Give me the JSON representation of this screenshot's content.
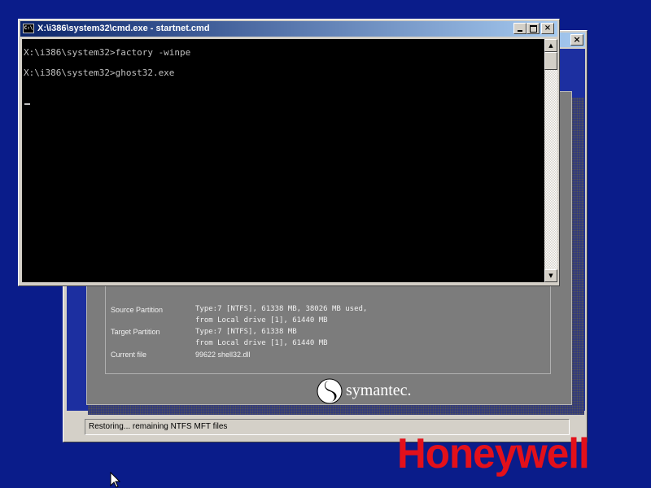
{
  "desktop": {
    "background_color": "#0a1c8a"
  },
  "ghost": {
    "close_glyph": "×",
    "details": [
      {
        "label": "Source Partition",
        "value": "Type:7 [NTFS], 61338 MB, 38026 MB used,"
      },
      {
        "label": "",
        "value": "from Local drive [1], 61440 MB"
      },
      {
        "label": "Target Partition",
        "value": "Type:7 [NTFS], 61338 MB"
      },
      {
        "label": "",
        "value": "from Local drive [1], 61440 MB"
      },
      {
        "label": "Current file",
        "value": "99622 shell32.dll"
      }
    ],
    "logo_text": "symantec.",
    "status_text": "Restoring... remaining NTFS MFT files"
  },
  "cmd": {
    "title": "X:\\i386\\system32\\cmd.exe - startnet.cmd",
    "icon_text": "C:\\",
    "buttons": {
      "close": "×"
    },
    "lines": [
      "X:\\i386\\system32>factory -winpe",
      "X:\\i386\\system32>ghost32.exe"
    ],
    "scroll_up": "▲",
    "scroll_down": "▼"
  },
  "watermark": {
    "text": "Honeywell",
    "color": "#e3101a"
  }
}
